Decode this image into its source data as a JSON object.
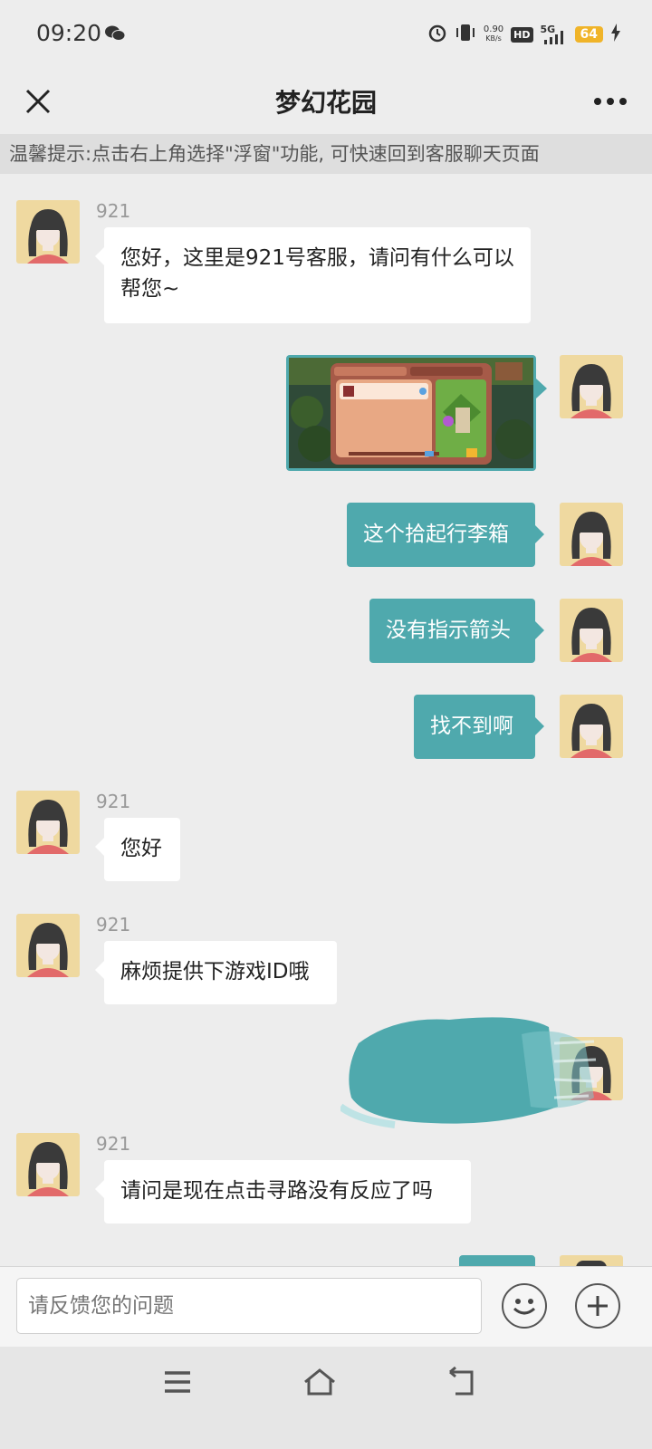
{
  "status_bar": {
    "time": "09:20",
    "speed_value": "0.90",
    "speed_unit": "KB/s",
    "hd": "HD",
    "network": "5G",
    "battery": "64",
    "icons": [
      "wechat-icon",
      "alarm-icon",
      "vibrate-icon",
      "signal-icon",
      "charging-icon"
    ]
  },
  "header": {
    "title": "梦幻花园",
    "close_icon": "close-icon",
    "more_icon": "more-icon"
  },
  "notice": "温馨提示:点击右上角选择\"浮窗\"功能, 可快速回到客服聊天页面",
  "colors": {
    "accent": "#4fa9ad",
    "background": "#ededed",
    "bubble_left": "#ffffff"
  },
  "messages": [
    {
      "from": "agent",
      "name": "921",
      "text": "您好，这里是921号客服，请问有什么可以帮您~"
    },
    {
      "from": "user",
      "type": "image",
      "image": "game-screenshot"
    },
    {
      "from": "user",
      "text": "这个拾起行李箱"
    },
    {
      "from": "user",
      "text": "没有指示箭头"
    },
    {
      "from": "user",
      "text": "找不到啊"
    },
    {
      "from": "agent",
      "name": "921",
      "text": "您好"
    },
    {
      "from": "agent",
      "name": "921",
      "text": "麻烦提供下游戏ID哦"
    },
    {
      "from": "user",
      "type": "redacted"
    },
    {
      "from": "agent",
      "name": "921",
      "text": "请问是现在点击寻路没有反应了吗"
    }
  ],
  "input": {
    "placeholder": "请反馈您的问题",
    "emoji_icon": "emoji-icon",
    "plus_icon": "plus-icon"
  },
  "system_nav": [
    "menu-icon",
    "home-icon",
    "back-icon"
  ]
}
